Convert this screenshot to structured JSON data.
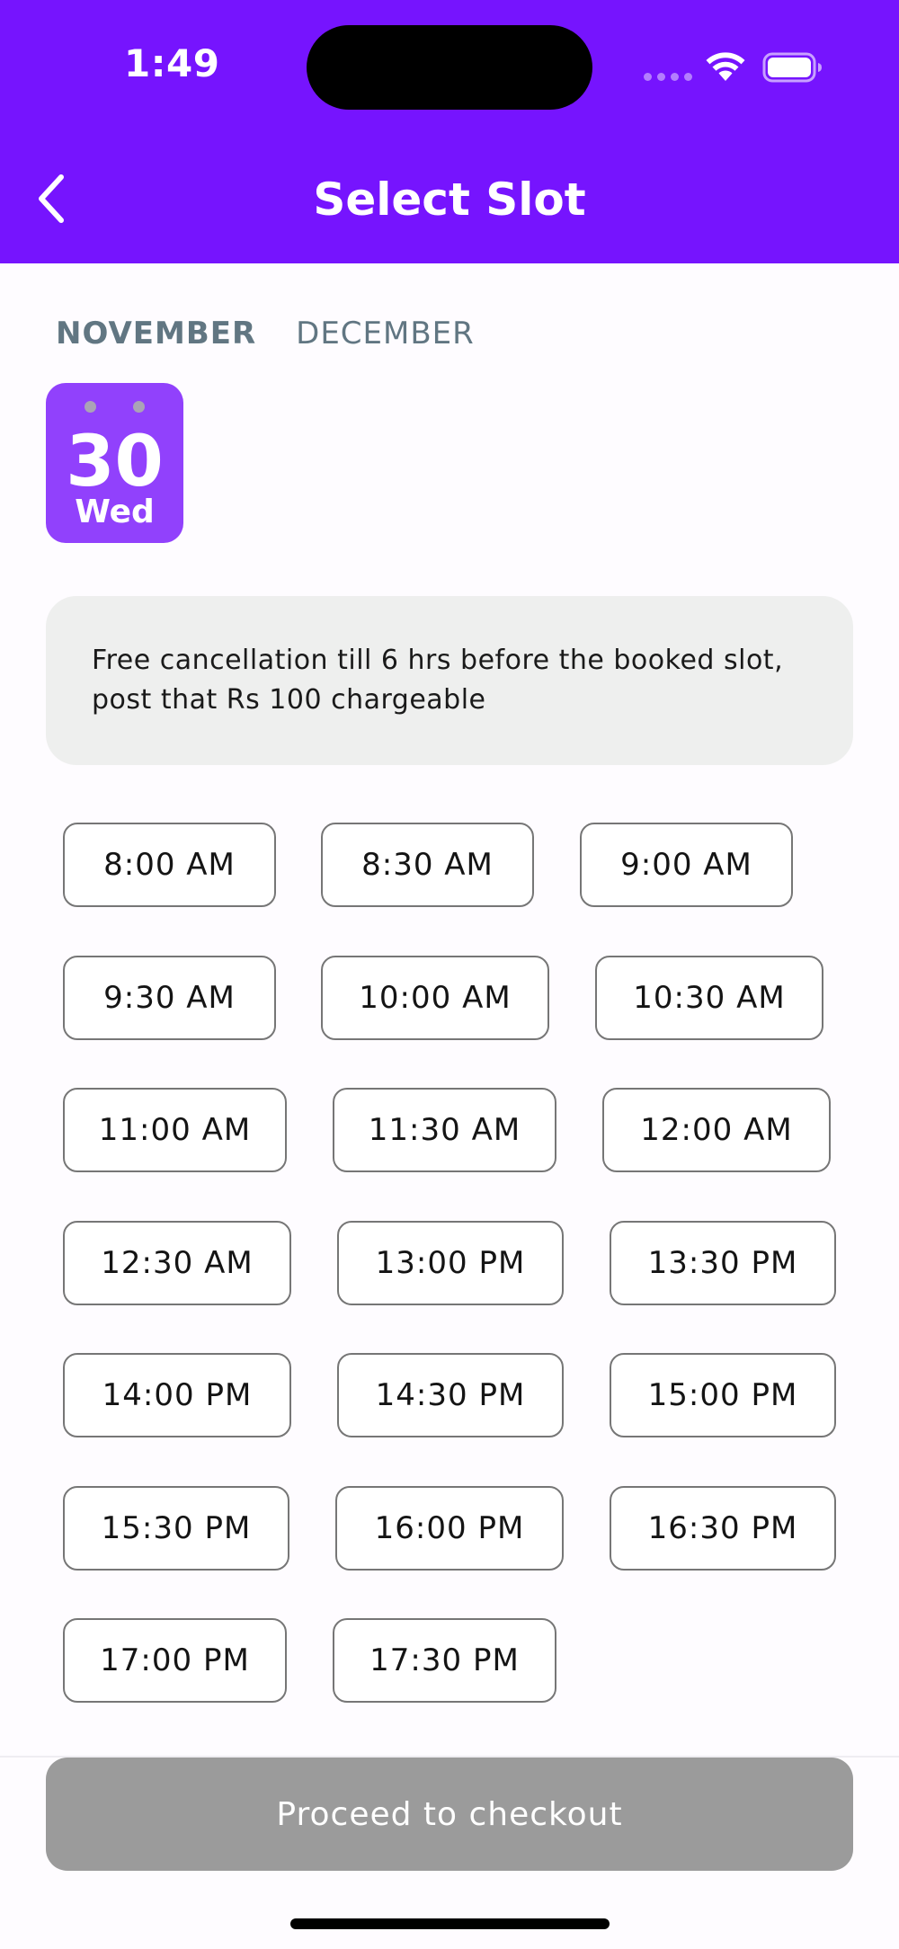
{
  "status_bar": {
    "time": "1:49"
  },
  "header": {
    "title": "Select Slot",
    "back_icon": "chevron-left-icon",
    "background": "#7614fe"
  },
  "months": [
    {
      "label": "NOVEMBER",
      "active": true
    },
    {
      "label": "DECEMBER",
      "active": false
    }
  ],
  "selected_date": {
    "day": "30",
    "weekday": "Wed",
    "color": "#9141fc"
  },
  "info": {
    "text": "Free cancellation till 6 hrs before the booked slot, post that Rs 100 chargeable"
  },
  "slots": [
    "8:00 AM",
    "8:30 AM",
    "9:00 AM",
    "9:30 AM",
    "10:00 AM",
    "10:30 AM",
    "11:00 AM",
    "11:30 AM",
    "12:00 AM",
    "12:30 AM",
    "13:00 PM",
    "13:30 PM",
    "14:00 PM",
    "14:30 PM",
    "15:00 PM",
    "15:30 PM",
    "16:00 PM",
    "16:30 PM",
    "17:00 PM",
    "17:30 PM"
  ],
  "footer": {
    "checkout_label": "Proceed to checkout",
    "checkout_color": "#9b9b9b"
  }
}
